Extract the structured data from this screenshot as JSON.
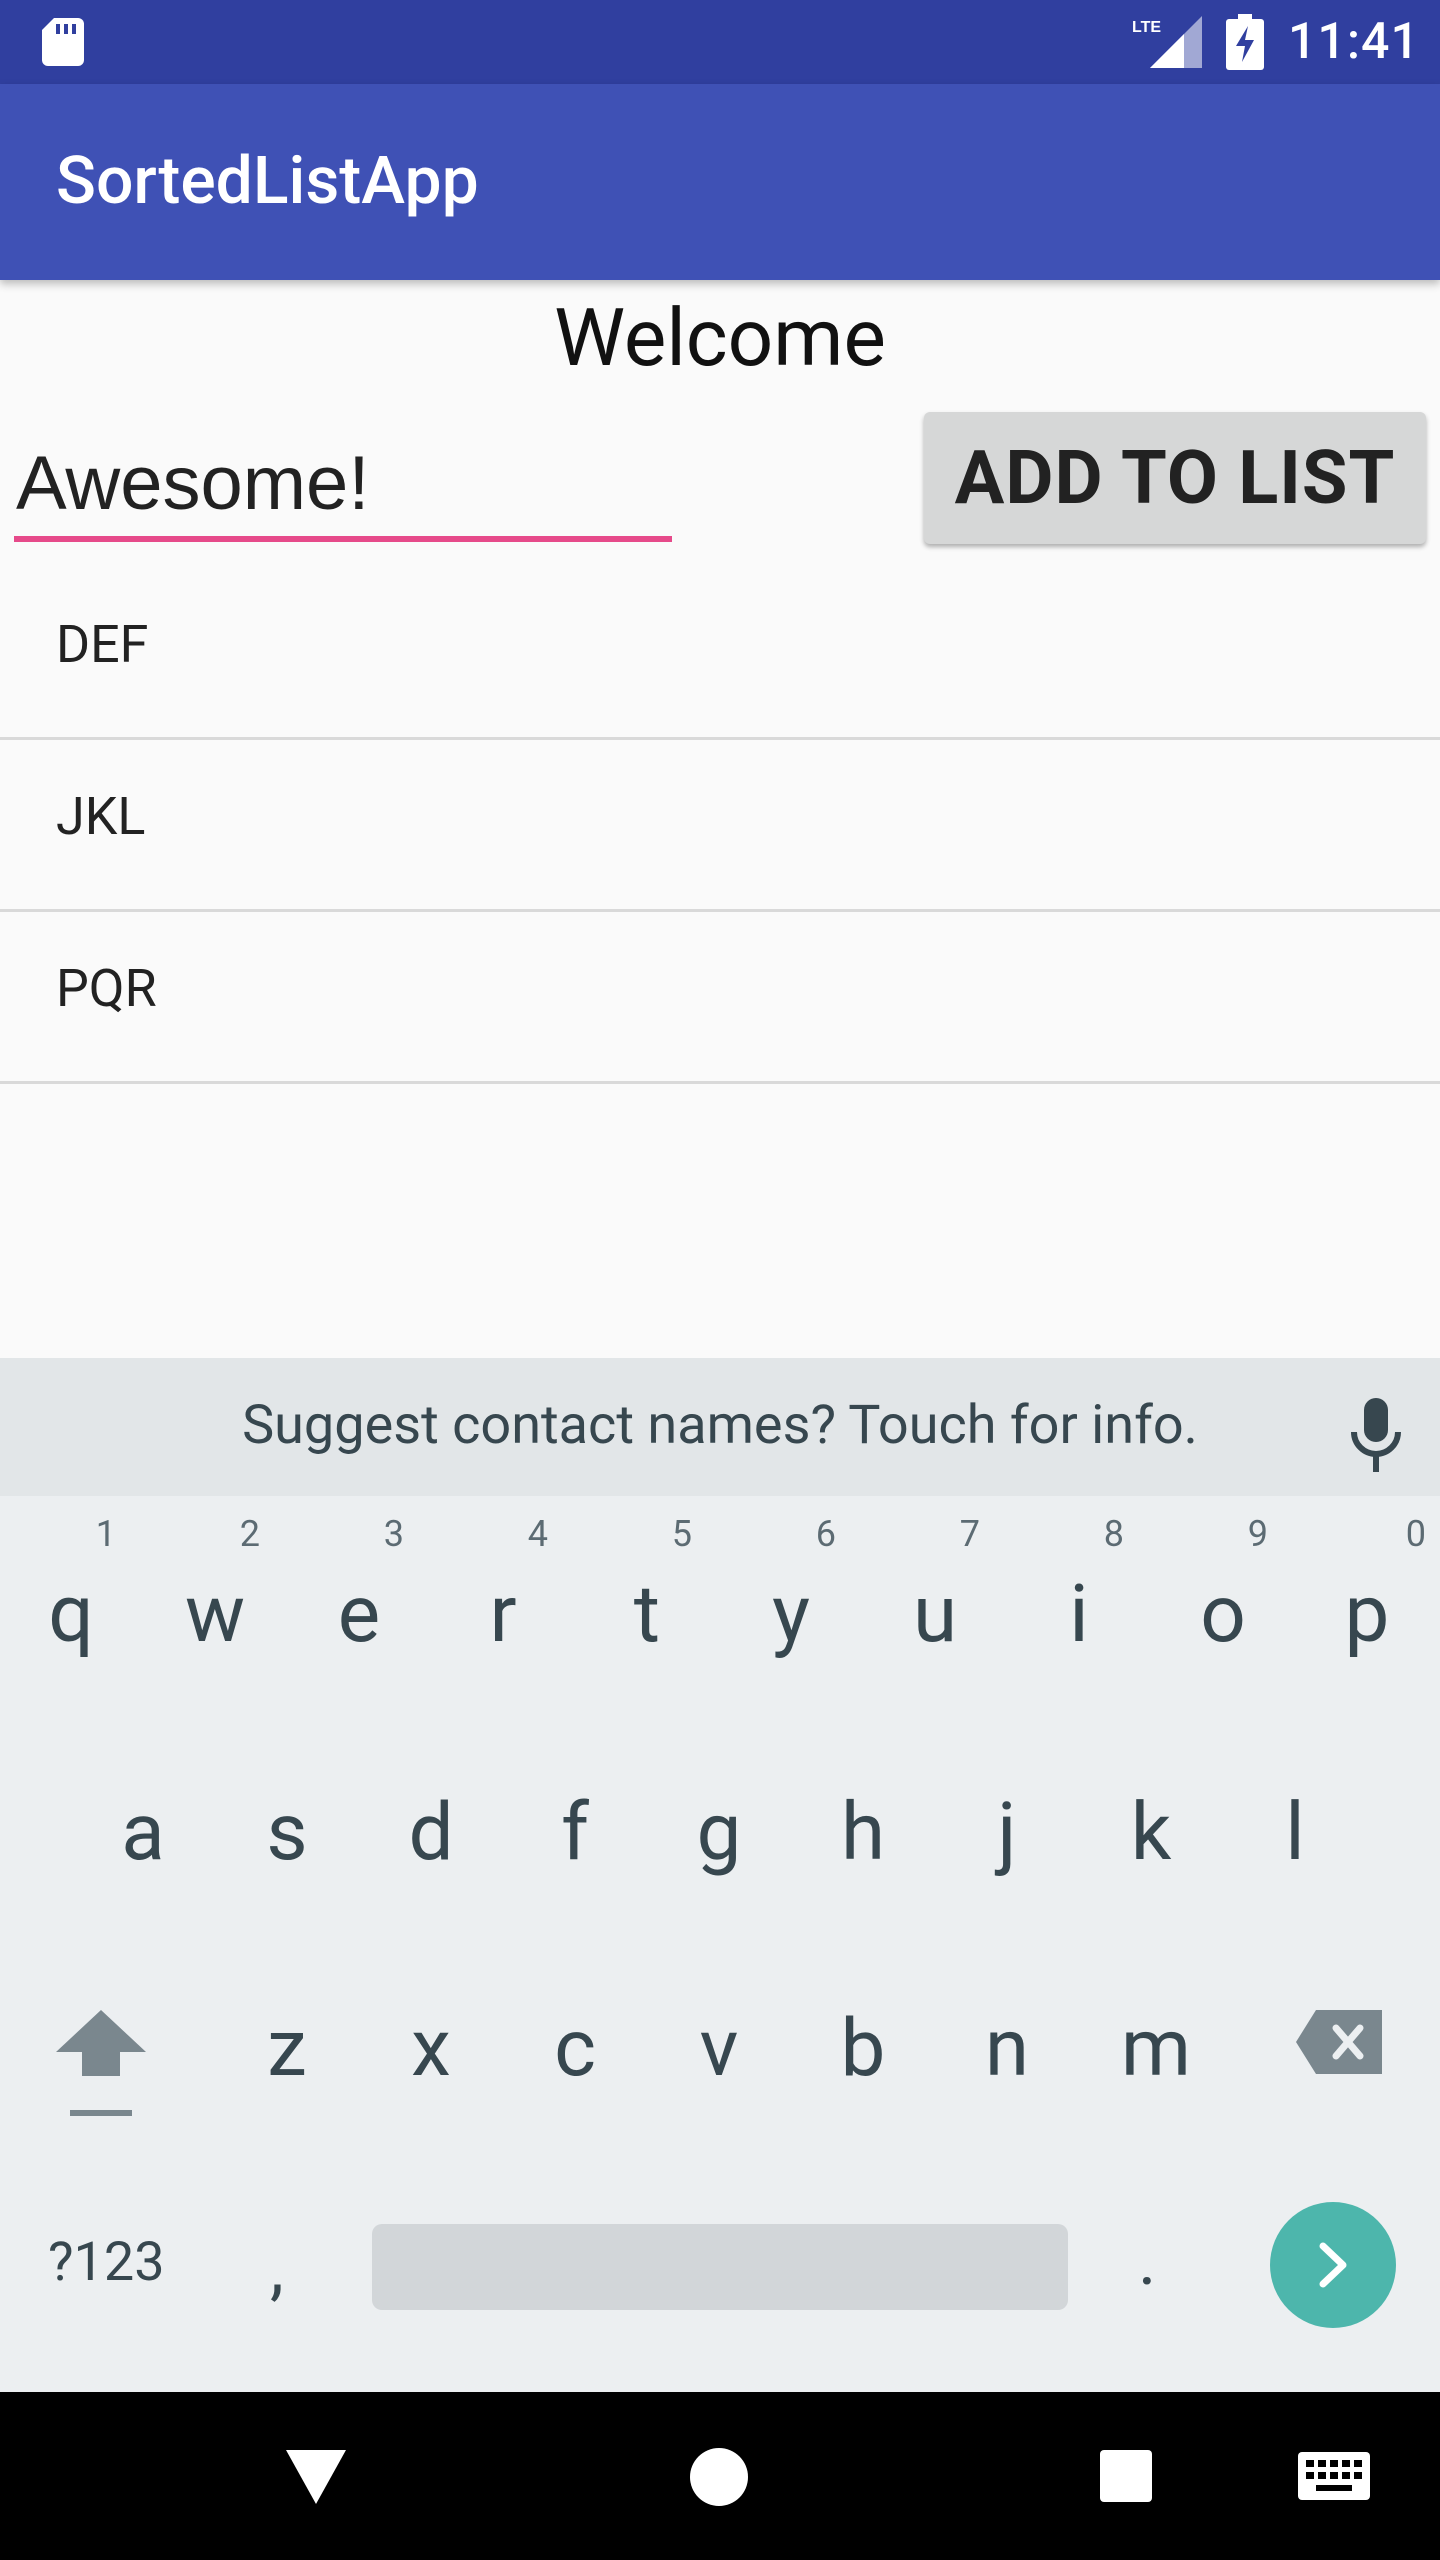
{
  "status_bar": {
    "time": "11:41",
    "network": "LTE",
    "icons": [
      "sd-card-icon",
      "lte-signal-icon",
      "battery-charging-icon"
    ]
  },
  "app_bar": {
    "title": "SortedListApp",
    "color": "#3f51b5"
  },
  "content": {
    "welcome": "Welcome",
    "input_value": "Awesome!",
    "add_button_label": "ADD TO LIST",
    "list_items": [
      "DEF",
      "JKL",
      "PQR"
    ]
  },
  "keyboard": {
    "suggestion": "Suggest contact names? Touch for info.",
    "row1": [
      {
        "key": "q",
        "hint": "1"
      },
      {
        "key": "w",
        "hint": "2"
      },
      {
        "key": "e",
        "hint": "3"
      },
      {
        "key": "r",
        "hint": "4"
      },
      {
        "key": "t",
        "hint": "5"
      },
      {
        "key": "y",
        "hint": "6"
      },
      {
        "key": "u",
        "hint": "7"
      },
      {
        "key": "i",
        "hint": "8"
      },
      {
        "key": "o",
        "hint": "9"
      },
      {
        "key": "p",
        "hint": "0"
      }
    ],
    "row2": [
      "a",
      "s",
      "d",
      "f",
      "g",
      "h",
      "j",
      "k",
      "l"
    ],
    "row3": [
      "z",
      "x",
      "c",
      "v",
      "b",
      "n",
      "m"
    ],
    "symbols_label": "?123",
    "comma": ",",
    "period": ".",
    "enter_color": "#4db6ac"
  },
  "nav_bar": {
    "icons": [
      "back-icon",
      "home-icon",
      "recents-icon",
      "keyboard-icon"
    ]
  }
}
